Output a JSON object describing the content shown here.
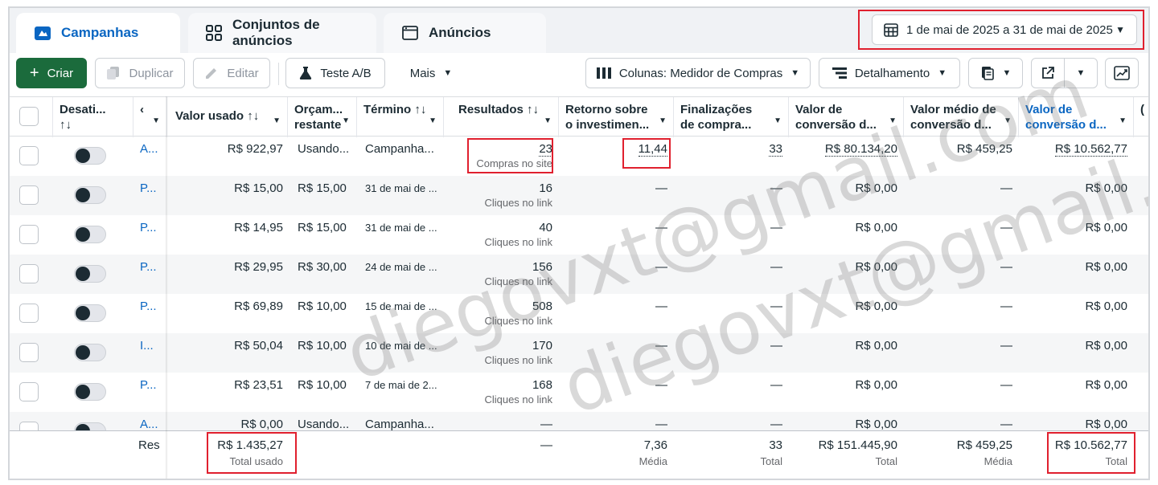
{
  "tabs": [
    {
      "label": "Campanhas",
      "icon": "campaign-folder-icon"
    },
    {
      "label": "Conjuntos de anúncios",
      "icon": "grid-icon"
    },
    {
      "label": "Anúncios",
      "icon": "ad-window-icon"
    }
  ],
  "date_range": "1 de mai de 2025 a 31 de mai de 2025",
  "toolbar": {
    "create": "Criar",
    "duplicate": "Duplicar",
    "edit": "Editar",
    "ab_test": "Teste A/B",
    "more": "Mais",
    "columns": "Colunas: Medidor de Compras",
    "breakdown": "Detalhamento"
  },
  "columns": {
    "deactivate": "Desati...",
    "name": "‹",
    "spend": "Valor usado ↑↓",
    "budget": "Orçam... restante",
    "end": "Término ↑↓",
    "results": "Resultados ↑↓",
    "roas": "Retorno sobre o investimen...",
    "checkouts": "Finalizações de compra...",
    "conv_value": "Valor de conversão d...",
    "avg_conv_value": "Valor médio de conversão d...",
    "conv_value2": "Valor de conversão d...",
    "extra": "("
  },
  "rows": [
    {
      "name": "A...",
      "spend": "R$ 922,97",
      "budget": "Usando...",
      "end": "Campanha...",
      "results": "23",
      "results_sub": "Compras no site",
      "roas": "11,44",
      "checkouts": "33",
      "conv_value": "R$ 80.134,20",
      "avg_conv_value": "R$ 459,25",
      "conv_value2": "R$ 10.562,77"
    },
    {
      "name": "P...",
      "spend": "R$ 15,00",
      "budget": "R$ 15,00",
      "end": "31 de mai de ...",
      "results": "16",
      "results_sub": "Cliques no link",
      "roas": "—",
      "checkouts": "—",
      "conv_value": "R$ 0,00",
      "avg_conv_value": "—",
      "conv_value2": "R$ 0,00"
    },
    {
      "name": "P...",
      "spend": "R$ 14,95",
      "budget": "R$ 15,00",
      "end": "31 de mai de ...",
      "results": "40",
      "results_sub": "Cliques no link",
      "roas": "—",
      "checkouts": "—",
      "conv_value": "R$ 0,00",
      "avg_conv_value": "—",
      "conv_value2": "R$ 0,00"
    },
    {
      "name": "P...",
      "spend": "R$ 29,95",
      "budget": "R$ 30,00",
      "end": "24 de mai de ...",
      "results": "156",
      "results_sub": "Cliques no link",
      "roas": "—",
      "checkouts": "—",
      "conv_value": "R$ 0,00",
      "avg_conv_value": "—",
      "conv_value2": "R$ 0,00"
    },
    {
      "name": "P...",
      "spend": "R$ 69,89",
      "budget": "R$ 10,00",
      "end": "15 de mai de ...",
      "results": "508",
      "results_sub": "Cliques no link",
      "roas": "—",
      "checkouts": "—",
      "conv_value": "R$ 0,00",
      "avg_conv_value": "—",
      "conv_value2": "R$ 0,00"
    },
    {
      "name": "I...",
      "spend": "R$ 50,04",
      "budget": "R$ 10,00",
      "end": "10 de mai de ...",
      "results": "170",
      "results_sub": "Cliques no link",
      "roas": "—",
      "checkouts": "—",
      "conv_value": "R$ 0,00",
      "avg_conv_value": "—",
      "conv_value2": "R$ 0,00"
    },
    {
      "name": "P...",
      "spend": "R$ 23,51",
      "budget": "R$ 10,00",
      "end": "7 de mai de 2...",
      "results": "168",
      "results_sub": "Cliques no link",
      "roas": "—",
      "checkouts": "—",
      "conv_value": "R$ 0,00",
      "avg_conv_value": "—",
      "conv_value2": "R$ 0,00"
    },
    {
      "name": "A...",
      "spend": "R$ 0,00",
      "budget": "Usando...",
      "end": "Campanha...",
      "results": "—",
      "results_sub": "",
      "roas": "—",
      "checkouts": "—",
      "conv_value": "R$ 0,00",
      "avg_conv_value": "—",
      "conv_value2": "R$ 0,00"
    }
  ],
  "footer": {
    "label": "Res",
    "spend": "R$ 1.435,27",
    "spend_sub": "Total usado",
    "results": "—",
    "roas": "7,36",
    "roas_sub": "Média",
    "checkouts": "33",
    "checkouts_sub": "Total",
    "conv_value": "R$ 151.445,90",
    "conv_value_sub": "Total",
    "avg_conv_value": "R$ 459,25",
    "avg_conv_value_sub": "Média",
    "conv_value2": "R$ 10.562,77",
    "conv_value2_sub": "Total"
  },
  "watermark": "diegovxt@gmail.com",
  "colors": {
    "accent": "#0a66c2",
    "create_button": "#1b6b3c",
    "highlight": "#e0202e"
  }
}
